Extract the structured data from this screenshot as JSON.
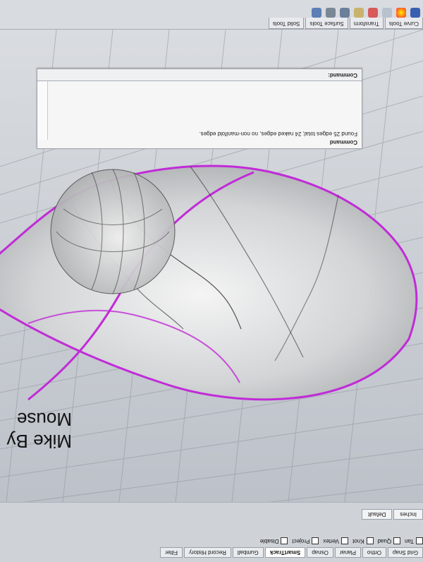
{
  "toolbar_tabs": [
    "Curve Tools",
    "Transform",
    "Surface Tools",
    "Solid Tools"
  ],
  "command": {
    "header": "Command",
    "line": "Found 25 edges total; 24 naked edges, no non-manifold edges.",
    "prompt": "Command:"
  },
  "status_pills": [
    "Grid Snap",
    "Ortho",
    "Planar",
    "Osnap",
    "SmartTrack",
    "Gumball",
    "Record History",
    "Filter"
  ],
  "status_on": [
    "SmartTrack"
  ],
  "osnap_labels": [
    "Tan",
    "Quad",
    "Knot",
    "Vertex",
    "Project",
    "Disable"
  ],
  "units": {
    "units": "Inches",
    "layer": "Default"
  },
  "caption": {
    "line1": "Mike By",
    "line2": "Mouse"
  }
}
